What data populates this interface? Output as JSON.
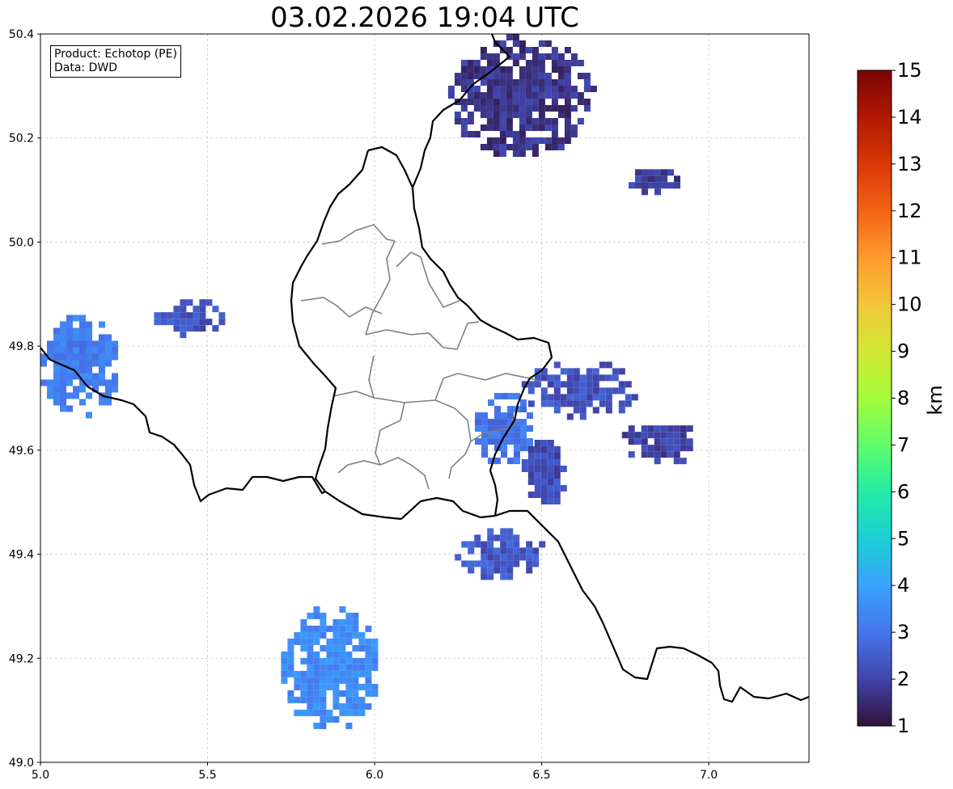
{
  "title": "03.02.2026 19:04 UTC",
  "info": {
    "product_line": "Product: Echotop (PE)",
    "data_line": "Data: DWD"
  },
  "colors": {
    "border_country": "#000000",
    "border_region": "#808080",
    "grid": "#c8c8c8"
  },
  "colorbar": {
    "unit": "km",
    "min": 1,
    "max": 15,
    "ticks": [
      "1",
      "2",
      "3",
      "4",
      "5",
      "6",
      "7",
      "8",
      "9",
      "10",
      "11",
      "12",
      "13",
      "14",
      "15"
    ],
    "stops": [
      "#30123b",
      "#4145ab",
      "#4675ed",
      "#39a2fc",
      "#1bcfd4",
      "#24eca6",
      "#61fc6c",
      "#a4fc3b",
      "#d1e834",
      "#f3c63a",
      "#fe9b2d",
      "#f36315",
      "#d93806",
      "#b11901",
      "#7a0402"
    ]
  },
  "chart_data": {
    "type": "heatmap",
    "x_ticks": [
      "5.0",
      "5.5",
      "6.0",
      "6.5",
      "7.0"
    ],
    "y_ticks": [
      "49.0",
      "49.2",
      "49.4",
      "49.6",
      "49.8",
      "50.0",
      "50.2",
      "50.4"
    ],
    "xlim": [
      5.0,
      7.3
    ],
    "ylim": [
      49.0,
      50.4
    ],
    "grid": true,
    "echo_cells": [
      {
        "lon_min": 5.0,
        "lon_max": 5.24,
        "lat_min": 49.66,
        "lat_max": 49.86,
        "height_km": 3.2
      },
      {
        "lon_min": 5.34,
        "lon_max": 5.56,
        "lat_min": 49.82,
        "lat_max": 49.89,
        "height_km": 2.3
      },
      {
        "lon_min": 6.22,
        "lon_max": 6.66,
        "lat_min": 50.16,
        "lat_max": 50.4,
        "height_km": 1.7
      },
      {
        "lon_min": 6.76,
        "lon_max": 6.92,
        "lat_min": 50.09,
        "lat_max": 50.14,
        "height_km": 1.9
      },
      {
        "lon_min": 6.3,
        "lon_max": 6.48,
        "lat_min": 49.57,
        "lat_max": 49.71,
        "height_km": 3.0
      },
      {
        "lon_min": 6.44,
        "lon_max": 6.8,
        "lat_min": 49.66,
        "lat_max": 49.77,
        "height_km": 2.3
      },
      {
        "lon_min": 6.44,
        "lon_max": 6.58,
        "lat_min": 49.49,
        "lat_max": 49.62,
        "height_km": 2.2
      },
      {
        "lon_min": 6.74,
        "lon_max": 6.98,
        "lat_min": 49.57,
        "lat_max": 49.66,
        "height_km": 2.0
      },
      {
        "lon_min": 6.24,
        "lon_max": 6.52,
        "lat_min": 49.35,
        "lat_max": 49.45,
        "height_km": 2.4
      },
      {
        "lon_min": 5.72,
        "lon_max": 6.02,
        "lat_min": 49.06,
        "lat_max": 49.3,
        "height_km": 3.5
      }
    ]
  }
}
